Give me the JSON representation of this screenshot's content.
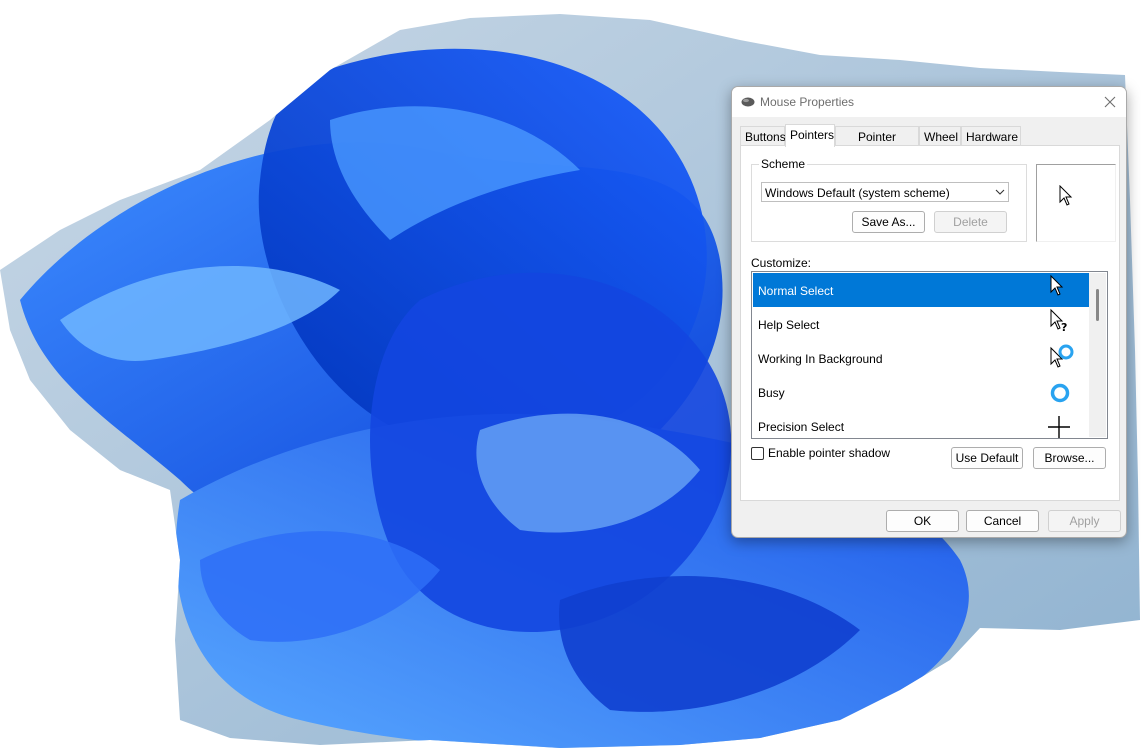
{
  "window": {
    "title": "Mouse Properties",
    "title_icon": "mouse-icon",
    "close_icon": "close-icon"
  },
  "tabs": [
    {
      "label": "Buttons",
      "active": false
    },
    {
      "label": "Pointers",
      "active": true
    },
    {
      "label": "Pointer Options",
      "active": false
    },
    {
      "label": "Wheel",
      "active": false
    },
    {
      "label": "Hardware",
      "active": false
    }
  ],
  "scheme": {
    "group_label": "Scheme",
    "selected_value": "Windows Default (system scheme)",
    "save_as_label": "Save As...",
    "delete_label": "Delete",
    "delete_enabled": false
  },
  "customize": {
    "label": "Customize:",
    "items": [
      {
        "label": "Normal Select",
        "icon": "arrow-cursor-icon",
        "selected": true
      },
      {
        "label": "Help Select",
        "icon": "help-cursor-icon",
        "selected": false
      },
      {
        "label": "Working In Background",
        "icon": "working-cursor-icon",
        "selected": false
      },
      {
        "label": "Busy",
        "icon": "busy-cursor-icon",
        "selected": false
      },
      {
        "label": "Precision Select",
        "icon": "crosshair-cursor-icon",
        "selected": false
      }
    ]
  },
  "options": {
    "pointer_shadow_label": "Enable pointer shadow",
    "pointer_shadow_checked": false,
    "use_default_label": "Use Default",
    "browse_label": "Browse..."
  },
  "footer": {
    "ok_label": "OK",
    "cancel_label": "Cancel",
    "apply_label": "Apply",
    "apply_enabled": false
  },
  "colors": {
    "selection": "#0078d7",
    "dialog_bg": "#f0f0f0",
    "busy_ring": "#29a3f0"
  }
}
